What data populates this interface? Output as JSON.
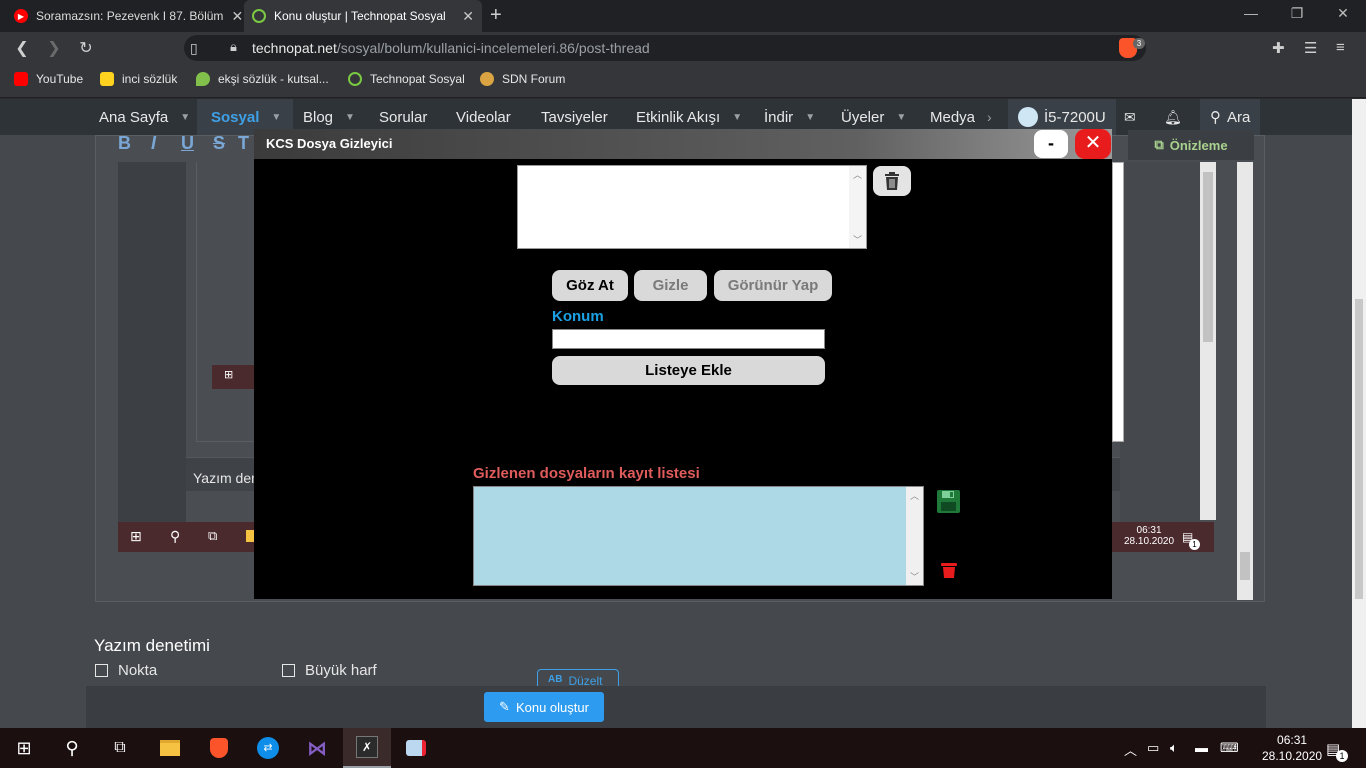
{
  "browser": {
    "tabs": [
      {
        "title": "Soramazsın: Pezevenk I 87. Bölüm",
        "favicon": "youtube-icon",
        "active": false
      },
      {
        "title": "Konu oluştur | Technopat Sosyal",
        "favicon": "power-icon",
        "active": true
      }
    ],
    "address": {
      "host": "technopat.net",
      "path": "/sosyal/bolum/kullanici-incelemeleri.86/post-thread"
    },
    "brave_badge": "3",
    "bookmarks": [
      {
        "label": "YouTube",
        "color": "#ff0000"
      },
      {
        "label": "inci sözlük",
        "color": "#ffd21f"
      },
      {
        "label": "ekşi sözlük - kutsal...",
        "color": "#81c14b"
      },
      {
        "label": "Technopat Sosyal",
        "color": "#7ac943"
      },
      {
        "label": "SDN Forum",
        "color": "#d9a441"
      }
    ]
  },
  "site_nav": {
    "items": [
      {
        "label": "Ana Sayfa",
        "caret": true
      },
      {
        "label": "Sosyal",
        "caret": true,
        "active": true
      },
      {
        "label": "Blog",
        "caret": true
      },
      {
        "label": "Sorular",
        "caret": false
      },
      {
        "label": "Videolar",
        "caret": false
      },
      {
        "label": "Tavsiyeler",
        "caret": false
      },
      {
        "label": "Etkinlik Akışı",
        "caret": true
      },
      {
        "label": "İndir",
        "caret": true
      },
      {
        "label": "Üyeler",
        "caret": true
      },
      {
        "label": "Medya",
        "caret": false
      }
    ],
    "user": "İ5-7200U",
    "search": "Ara"
  },
  "editor": {
    "format_buttons": [
      "B",
      "I",
      "U",
      "S",
      "T"
    ],
    "preview_label": "Önizleme",
    "behind_text": "Yazım den",
    "inner_clock_time": "06:31",
    "inner_clock_date": "28.10.2020",
    "inner_notify": "1"
  },
  "spellcheck": {
    "title": "Yazım denetimi",
    "options": [
      "Nokta",
      "Büyük harf"
    ],
    "fix_icon": "AB",
    "fix_label": "Düzelt"
  },
  "submit": {
    "label": "Konu oluştur"
  },
  "kcs": {
    "title": "KCS Dosya Gizleyici",
    "minimize": "-",
    "close": "✕",
    "buttons": {
      "browse": "Göz At",
      "hide": "Gizle",
      "show": "Görünür Yap"
    },
    "location_label": "Konum",
    "location_value": "",
    "add_to_list": "Listeye Ekle",
    "log_label": "Gizlenen dosyaların kayıt listesi",
    "colors": {
      "location": "#1ba1e2",
      "log_label": "#e05c5c",
      "log_bg": "#add8e6",
      "close": "#e81c1c"
    }
  },
  "taskbar": {
    "apps": [
      "start-icon",
      "search-icon",
      "task-view-icon",
      "file-explorer-icon",
      "brave-icon",
      "teamviewer-icon",
      "visual-studio-icon",
      "app-icon",
      "remote-icon"
    ],
    "time": "06:31",
    "date": "28.10.2020",
    "notify_count": "1"
  }
}
